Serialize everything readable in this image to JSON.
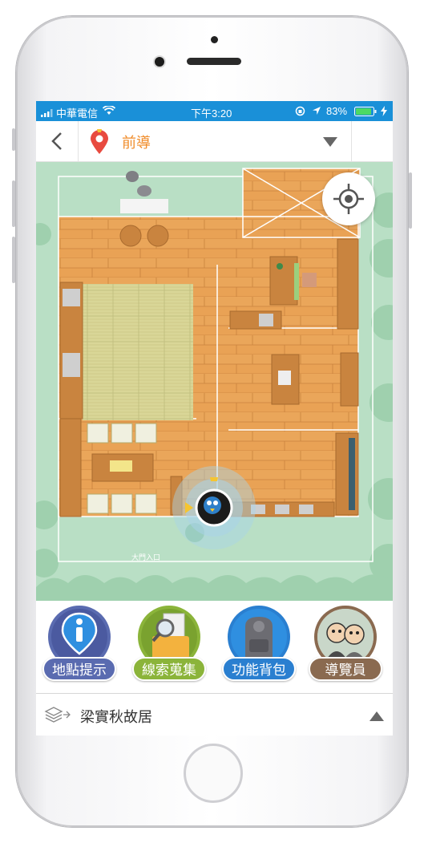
{
  "status_bar": {
    "carrier": "中華電信",
    "time": "下午3:20",
    "battery": "83%"
  },
  "header": {
    "title": "前導"
  },
  "map": {
    "entrance_label": "大門入口"
  },
  "toolbar": {
    "buttons": [
      {
        "label": "地點提示",
        "color": "#5a6bb0"
      },
      {
        "label": "線索蒐集",
        "color": "#8bb43a"
      },
      {
        "label": "功能背包",
        "color": "#2a7fd0"
      },
      {
        "label": "導覽員",
        "color": "#8a6a50"
      }
    ]
  },
  "bottom_bar": {
    "location": "梁實秋故居"
  },
  "colors": {
    "status_bar": "#1a90d8",
    "accent": "#f08c2a",
    "map_grass": "#b9dfc5",
    "floor": "#e9a255"
  }
}
